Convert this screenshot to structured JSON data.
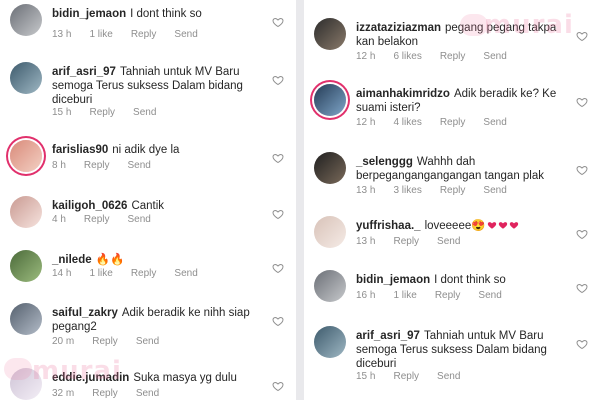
{
  "colors": {
    "ring": "#e1306c",
    "watermark": "#ec78a0"
  },
  "icons": {
    "like": "heart-outline-icon"
  },
  "watermark": {
    "text": "murai"
  },
  "left": [
    {
      "username": "bidin_jemaon",
      "text": "I dont think so",
      "time": "13 h",
      "likes": "1 like",
      "reply": "Reply",
      "send": "Send"
    },
    {
      "username": "arif_asri_97",
      "text": "Tahniah untuk MV Baru semoga Terus suksess Dalam bidang diceburi",
      "time": "15 h",
      "likes": "",
      "reply": "Reply",
      "send": "Send"
    },
    {
      "username": "farislias90",
      "text": "ni adik dye la",
      "time": "8 h",
      "likes": "",
      "reply": "Reply",
      "send": "Send"
    },
    {
      "username": "kailigoh_0626",
      "text": "Cantik",
      "time": "4 h",
      "likes": "",
      "reply": "Reply",
      "send": "Send"
    },
    {
      "username": "_nilede",
      "text": "🔥🔥",
      "time": "14 h",
      "likes": "1 like",
      "reply": "Reply",
      "send": "Send"
    },
    {
      "username": "saiful_zakry",
      "text": "Adik beradik ke nihh siap pegang2",
      "time": "20 m",
      "likes": "",
      "reply": "Reply",
      "send": "Send"
    },
    {
      "username": "eddie.jumadin",
      "text": "Suka masya yg dulu",
      "time": "32 m",
      "likes": "",
      "reply": "Reply",
      "send": "Send"
    }
  ],
  "right": [
    {
      "username": "izzataziziazman",
      "text": "pegang pegang takpa kan belakon",
      "time": "12 h",
      "likes": "6 likes",
      "reply": "Reply",
      "send": "Send"
    },
    {
      "username": "aimanhakimridzo",
      "text": "Adik beradik ke? Ke suami isteri?",
      "time": "12 h",
      "likes": "4 likes",
      "reply": "Reply",
      "send": "Send"
    },
    {
      "username": "_selenggg",
      "text": "Wahhh dah berpegangangangangan tangan plak",
      "time": "13 h",
      "likes": "3 likes",
      "reply": "Reply",
      "send": "Send"
    },
    {
      "username": "yuffrishaa._",
      "text": "loveeeee😍",
      "time": "13 h",
      "likes": "",
      "reply": "Reply",
      "send": "Send"
    },
    {
      "username": "bidin_jemaon",
      "text": "I dont think so",
      "time": "16 h",
      "likes": "1 like",
      "reply": "Reply",
      "send": "Send"
    },
    {
      "username": "arif_asri_97",
      "text": "Tahniah untuk MV Baru semoga Terus suksess Dalam bidang diceburi",
      "time": "15 h",
      "likes": "",
      "reply": "Reply",
      "send": "Send"
    }
  ]
}
